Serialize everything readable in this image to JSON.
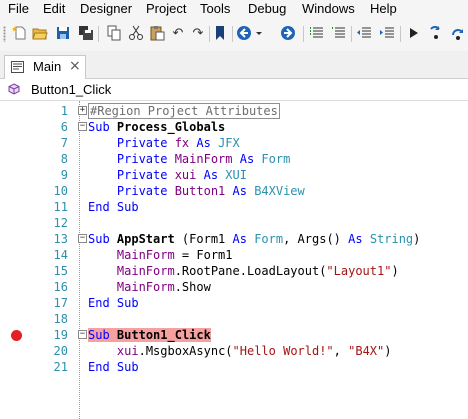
{
  "menu": [
    "File",
    "Edit",
    "Designer",
    "Project",
    "Tools",
    "Debug",
    "Windows",
    "Help"
  ],
  "toolbar_icons": [
    "new-file-icon",
    "open-folder-icon",
    "save-icon",
    "save-all-icon",
    "copy-icon",
    "cut-icon",
    "paste-icon",
    "undo-icon",
    "redo-icon",
    "bookmark-icon",
    "navigate-back-icon",
    "dropdown-arrow-icon",
    "navigate-forward-icon",
    "comment-icon",
    "uncomment-icon",
    "outdent-icon",
    "indent-icon",
    "run-icon",
    "step-icon",
    "step-over-icon"
  ],
  "tab": {
    "label": "Main",
    "close": "×"
  },
  "subbar": {
    "label": "Button1_Click"
  },
  "editor": {
    "lines": [
      {
        "num": "1",
        "fold": "+",
        "tokens": [
          {
            "c": "region",
            "t": "#Region Project Attributes"
          }
        ]
      },
      {
        "num": "6",
        "fold": "−",
        "tokens": [
          {
            "c": "kw",
            "t": "Sub "
          },
          {
            "c": "bd",
            "t": "Process_Globals"
          }
        ]
      },
      {
        "num": "7",
        "tokens": [
          {
            "c": "tx",
            "t": "    "
          },
          {
            "c": "kw",
            "t": "Private "
          },
          {
            "c": "gv",
            "t": "fx"
          },
          {
            "c": "kw",
            "t": " As "
          },
          {
            "c": "ty",
            "t": "JFX"
          }
        ]
      },
      {
        "num": "8",
        "tokens": [
          {
            "c": "tx",
            "t": "    "
          },
          {
            "c": "kw",
            "t": "Private "
          },
          {
            "c": "gv",
            "t": "MainForm"
          },
          {
            "c": "kw",
            "t": " As "
          },
          {
            "c": "ty",
            "t": "Form"
          }
        ]
      },
      {
        "num": "9",
        "tokens": [
          {
            "c": "tx",
            "t": "    "
          },
          {
            "c": "kw",
            "t": "Private "
          },
          {
            "c": "gv",
            "t": "xui"
          },
          {
            "c": "kw",
            "t": " As "
          },
          {
            "c": "ty",
            "t": "XUI"
          }
        ]
      },
      {
        "num": "10",
        "tokens": [
          {
            "c": "tx",
            "t": "    "
          },
          {
            "c": "kw",
            "t": "Private "
          },
          {
            "c": "gv",
            "t": "Button1"
          },
          {
            "c": "kw",
            "t": " As "
          },
          {
            "c": "ty",
            "t": "B4XView"
          }
        ]
      },
      {
        "num": "11",
        "tokens": [
          {
            "c": "kw",
            "t": "End Sub"
          }
        ]
      },
      {
        "num": "12",
        "tokens": []
      },
      {
        "num": "13",
        "fold": "−",
        "tokens": [
          {
            "c": "kw",
            "t": "Sub "
          },
          {
            "c": "bd",
            "t": "AppStart"
          },
          {
            "c": "tx",
            "t": " (Form1 "
          },
          {
            "c": "kw",
            "t": "As "
          },
          {
            "c": "ty",
            "t": "Form"
          },
          {
            "c": "tx",
            "t": ", Args() "
          },
          {
            "c": "kw",
            "t": "As "
          },
          {
            "c": "ty",
            "t": "String"
          },
          {
            "c": "tx",
            "t": ")"
          }
        ]
      },
      {
        "num": "14",
        "tokens": [
          {
            "c": "tx",
            "t": "    "
          },
          {
            "c": "gv",
            "t": "MainForm"
          },
          {
            "c": "tx",
            "t": " = Form1"
          }
        ]
      },
      {
        "num": "15",
        "tokens": [
          {
            "c": "tx",
            "t": "    "
          },
          {
            "c": "gv",
            "t": "MainForm"
          },
          {
            "c": "tx",
            "t": ".RootPane.LoadLayout("
          },
          {
            "c": "st",
            "t": "\"Layout1\""
          },
          {
            "c": "tx",
            "t": ")"
          }
        ]
      },
      {
        "num": "16",
        "tokens": [
          {
            "c": "tx",
            "t": "    "
          },
          {
            "c": "gv",
            "t": "MainForm"
          },
          {
            "c": "tx",
            "t": ".Show"
          }
        ]
      },
      {
        "num": "17",
        "tokens": [
          {
            "c": "kw",
            "t": "End Sub"
          }
        ]
      },
      {
        "num": "18",
        "tokens": []
      },
      {
        "num": "19",
        "fold": "−",
        "breakpoint": true,
        "tokens": [
          {
            "c": "kw hl",
            "t": "Sub"
          },
          {
            "c": "hl",
            "t": " "
          },
          {
            "c": "bd hl",
            "t": "Button1_Click"
          }
        ]
      },
      {
        "num": "20",
        "tokens": [
          {
            "c": "tx",
            "t": "    "
          },
          {
            "c": "gv",
            "t": "xui"
          },
          {
            "c": "tx",
            "t": ".MsgboxAsync("
          },
          {
            "c": "st",
            "t": "\"Hello World!\""
          },
          {
            "c": "tx",
            "t": ", "
          },
          {
            "c": "st",
            "t": "\"B4X\""
          },
          {
            "c": "tx",
            "t": ")"
          }
        ]
      },
      {
        "num": "21",
        "tokens": [
          {
            "c": "kw",
            "t": "End Sub"
          }
        ]
      }
    ]
  }
}
